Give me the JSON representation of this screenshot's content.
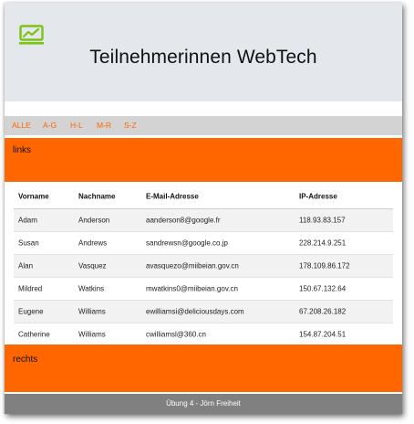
{
  "header": {
    "logo_icon": "line-chart-icon",
    "title": "Teilnehmerinnen WebTech",
    "accent_color": "#7cc414"
  },
  "nav": {
    "items": [
      "ALLE",
      "A-G",
      "H-L",
      "M-R",
      "S-Z"
    ],
    "color": "#ff6600"
  },
  "links_panel": {
    "label": "links",
    "color": "#ff6600"
  },
  "table": {
    "headers": [
      "Vorname",
      "Nachname",
      "E-Mail-Adresse",
      "IP-Adresse"
    ],
    "rows": [
      [
        "Adam",
        "Anderson",
        "aanderson8@google.fr",
        "118.93.83.157"
      ],
      [
        "Susan",
        "Andrews",
        "sandrewsn@google.co.jp",
        "228.214.9.251"
      ],
      [
        "Alan",
        "Vasquez",
        "avasquezo@miibeian.gov.cn",
        "178.109.86.172"
      ],
      [
        "Mildred",
        "Watkins",
        "mwatkins0@miibeian.gov.cn",
        "150.67.132.64"
      ],
      [
        "Eugene",
        "Williams",
        "ewilliamsi@deliciousdays.com",
        "67.208.26.182"
      ],
      [
        "Catherine",
        "Williams",
        "cwilliamsl@360.cn",
        "154.87.204.51"
      ]
    ]
  },
  "rechts_panel": {
    "label": "rechts"
  },
  "footer": {
    "text": "Übung 4 - Jörn Freiheit"
  }
}
